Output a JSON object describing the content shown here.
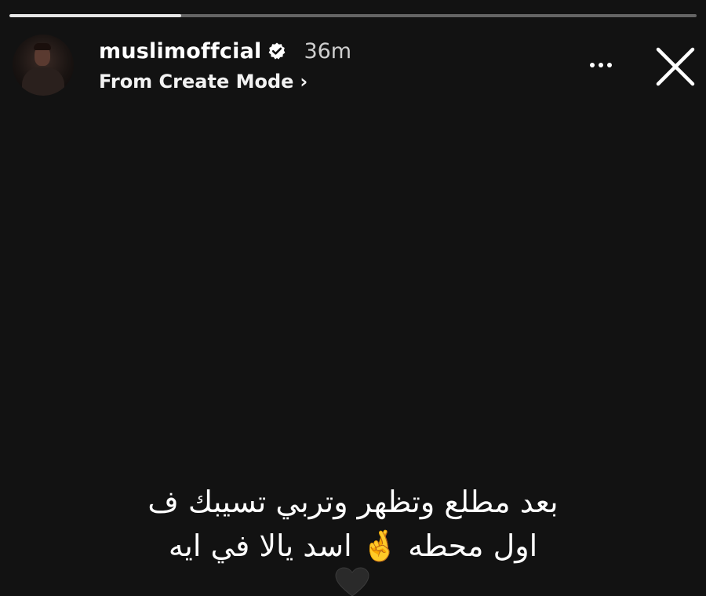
{
  "story": {
    "progress": 0.25,
    "username": "muslimoffcial",
    "verified": true,
    "time": "36m",
    "subtitle": "From Create Mode",
    "subtitle_chevron": "›",
    "caption_line1": "بعد مطلع وتظهر وتربي تسيبك ف",
    "caption_line2": "اول محطه 🤞 اسد يالا في ايه",
    "icons": {
      "avatar": "profile-avatar",
      "verified": "verified-badge-icon",
      "more": "more-options-icon",
      "close": "close-icon",
      "heart": "black-heart-icon"
    },
    "colors": {
      "background": "#121212",
      "text": "#ffffff",
      "progress_track": "#5a5a5a",
      "progress_fill": "#e6e6e6"
    }
  }
}
